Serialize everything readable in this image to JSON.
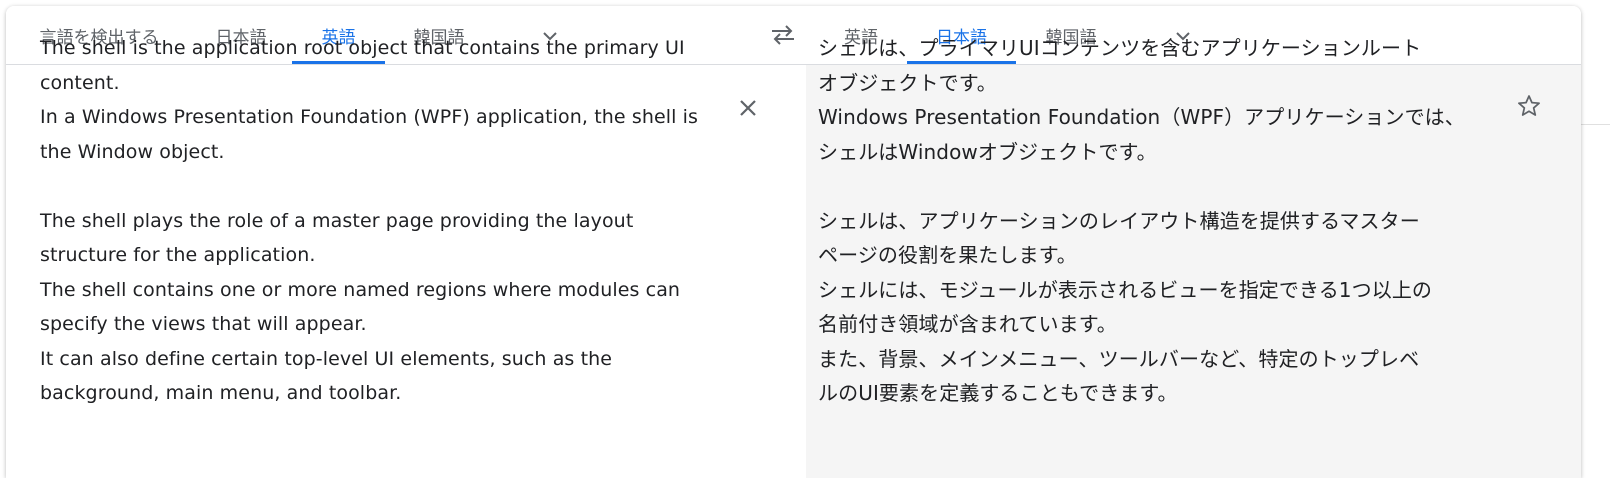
{
  "source_language_tabs": [
    {
      "label": "言語を検出する",
      "active": false
    },
    {
      "label": "日本語",
      "active": false
    },
    {
      "label": "英語",
      "active": true
    },
    {
      "label": "韓国語",
      "active": false
    }
  ],
  "target_language_tabs": [
    {
      "label": "英語",
      "active": false
    },
    {
      "label": "日本語",
      "active": true
    },
    {
      "label": "韓国語",
      "active": false
    }
  ],
  "icons": {
    "more_source": "chevron-down-icon",
    "swap": "swap-arrows-icon",
    "more_target": "chevron-down-icon",
    "clear": "close-icon",
    "save": "star-icon"
  },
  "colors": {
    "accent": "#1a73e8",
    "tab_text": "#5f6368",
    "body_text": "#202124",
    "target_bg": "#f5f5f5"
  },
  "source_text": "The shell is the application root object that contains the primary UI\ncontent.\nIn a Windows Presentation Foundation (WPF) application, the shell is\nthe Window object.\n\nThe shell plays the role of a master page providing the layout\nstructure for the application.\nThe shell contains one or more named regions where modules can\nspecify the views that will appear.\nIt can also define certain top-level UI elements, such as the\nbackground, main menu, and toolbar.",
  "translated_text": "シェルは、プライマリUIコンテンツを含むアプリケーションルート\nオブジェクトです。\nWindows Presentation Foundation（WPF）アプリケーションでは、\nシェルはWindowオブジェクトです。\n\nシェルは、アプリケーションのレイアウト構造を提供するマスター\nページの役割を果たします。\nシェルには、モジュールが表示されるビューを指定できる1つ以上の\n名前付き領域が含まれています。\nまた、背景、メインメニュー、ツールバーなど、特定のトップレベ\nルのUI要素を定義することもできます。"
}
